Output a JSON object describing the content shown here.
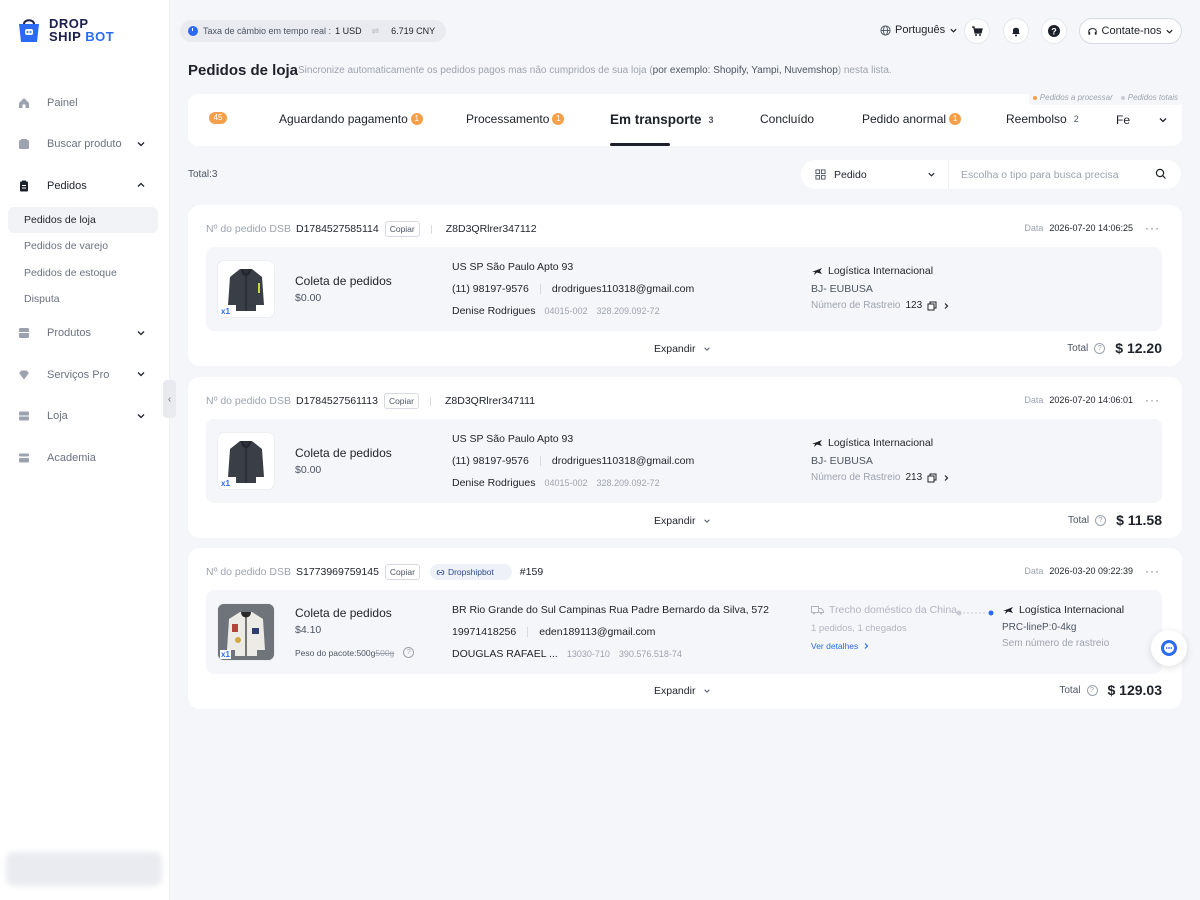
{
  "app": {
    "logo_line1": "DROP",
    "logo_line2_a": "SHIP",
    "logo_line2_b": "BOT",
    "brand_color": "#2b6bf3"
  },
  "sidebar": {
    "items": [
      {
        "label": "Painel",
        "icon": "home-icon"
      },
      {
        "label": "Buscar produto",
        "icon": "search-product-icon"
      },
      {
        "label": "Pedidos",
        "icon": "clipboard-icon"
      },
      {
        "label": "Produtos",
        "icon": "box-icon"
      },
      {
        "label": "Serviços Pro",
        "icon": "diamond-icon"
      },
      {
        "label": "Loja",
        "icon": "store-icon"
      },
      {
        "label": "Academia",
        "icon": "academy-icon"
      }
    ],
    "sub_items": [
      "Pedidos de loja",
      "Pedidos de varejo",
      "Pedidos de estoque",
      "Disputa"
    ]
  },
  "topbar": {
    "rate_label": "Taxa de câmbio em tempo real :",
    "rate_from": "1 USD",
    "rate_to": "6.719 CNY",
    "language": "Português",
    "contact": "Contate-nos"
  },
  "header": {
    "title": "Pedidos de loja",
    "desc_a": "Sincronize automaticamente os pedidos pagos mas não cumpridos de sua loja (",
    "desc_b": "por exemplo: Shopify, Yampi, Nuvemshop",
    "desc_c": ") nesta lista."
  },
  "legend": {
    "to_process": "Pedidos a processar",
    "total": "Pedidos totais"
  },
  "tabs": [
    {
      "label": "",
      "badge": "45"
    },
    {
      "label": "Aguardando pagamento",
      "badge": "1"
    },
    {
      "label": "Processamento",
      "badge": "1"
    },
    {
      "label": "Em transporte",
      "count": "3",
      "active": true
    },
    {
      "label": "Concluído"
    },
    {
      "label": "Pedido anormal",
      "badge": "1"
    },
    {
      "label": "Reembolso",
      "count": "2"
    },
    {
      "label": "Fe"
    }
  ],
  "filter": {
    "total_label": "Total:",
    "total_value": "3",
    "select_value": "Pedido",
    "search_placeholder": "Escolha o tipo para busca precisa"
  },
  "orders": [
    {
      "no_label": "Nº do pedido DSB",
      "no": "D1784527585114",
      "copy": "Copiar",
      "ext_id": "Z8D3QRlrer347112",
      "date_label": "Data",
      "date": "2026-07-20 14:06:25",
      "product": "Coleta de pedidos",
      "price": "$0.00",
      "qty": "x1",
      "address": "US SP São Paulo Apto 93",
      "phone": "(11) 98197-9576",
      "email": "drodrigues110318@gmail.com",
      "customer": "Denise Rodrigues",
      "zip": "04015-002",
      "doc": "328.209.092-72",
      "logistics": "Logística Internacional",
      "route": "BJ- EUBUSA",
      "tracking_label": "Número de Rastreio",
      "tracking": "123",
      "expand": "Expandir",
      "total_label": "Total",
      "total": "$ 12.20"
    },
    {
      "no_label": "Nº do pedido DSB",
      "no": "D1784527561113",
      "copy": "Copiar",
      "ext_id": "Z8D3QRlrer347111",
      "date_label": "Data",
      "date": "2026-07-20 14:06:01",
      "product": "Coleta de pedidos",
      "price": "$0.00",
      "qty": "x1",
      "address": "US SP São Paulo Apto 93",
      "phone": "(11) 98197-9576",
      "email": "drodrigues110318@gmail.com",
      "customer": "Denise Rodrigues",
      "zip": "04015-002",
      "doc": "328.209.092-72",
      "logistics": "Logística Internacional",
      "route": "BJ- EUBUSA",
      "tracking_label": "Número de Rastreio",
      "tracking": "213",
      "expand": "Expandir",
      "total_label": "Total",
      "total": "$ 11.58"
    },
    {
      "no_label": "Nº do pedido DSB",
      "no": "S1773969759145",
      "copy": "Copiar",
      "platform": "Dropshipbot",
      "ext_id": "#159",
      "date_label": "Data",
      "date": "2026-03-20 09:22:39",
      "product": "Coleta de pedidos",
      "price": "$4.10",
      "qty": "x1",
      "weight_label": "Peso do pacote:",
      "weight": "500g",
      "weight_old": "500g",
      "address": "BR Rio Grande do Sul Campinas Rua Padre Bernardo da Silva, 572",
      "phone": "19971418256",
      "email": "eden189113@gmail.com",
      "customer": "DOUGLAS RAFAEL ...",
      "zip": "13030-710",
      "doc": "390.576.518-74",
      "domestic": "Trecho doméstico da China",
      "domestic_sub": "1 pedidos, 1 chegados",
      "details_link": "Ver detalhes",
      "logistics": "Logística Internacional",
      "route": "PRC-lineP:0-4kg",
      "no_tracking": "Sem número de rastreio",
      "expand": "Expandir",
      "total_label": "Total",
      "total": "$ 129.03"
    }
  ]
}
